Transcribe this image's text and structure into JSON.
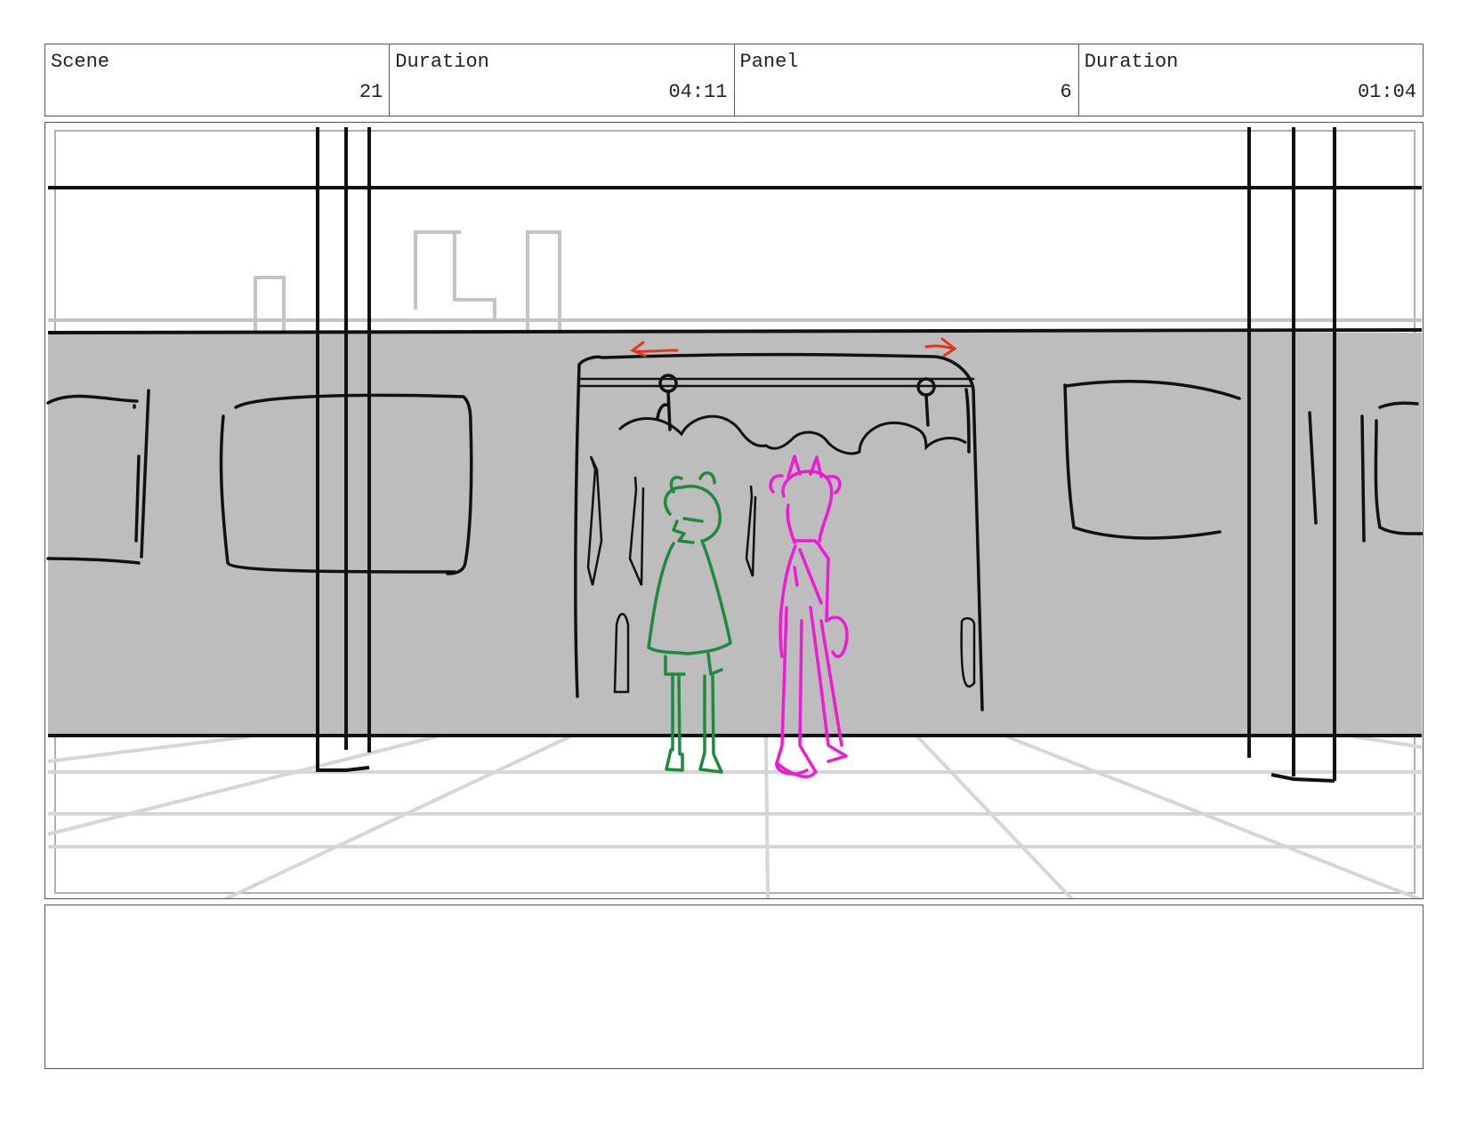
{
  "header": {
    "scene_label": "Scene",
    "scene_value": "21",
    "scene_duration_label": "Duration",
    "scene_duration_value": "04:11",
    "panel_label": "Panel",
    "panel_value": "6",
    "panel_duration_label": "Duration",
    "panel_duration_value": "01:04"
  },
  "notes": {
    "text": ""
  }
}
